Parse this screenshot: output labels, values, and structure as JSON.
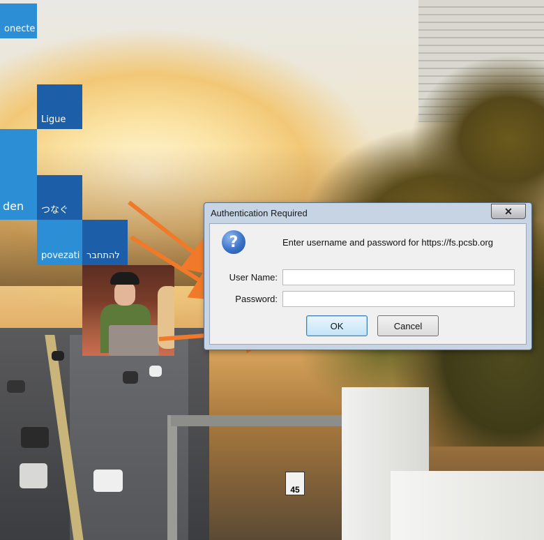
{
  "tiles": {
    "conecte": "onecte",
    "ligue": "Ligue",
    "den": "den",
    "tsunagu": "つなぐ",
    "povezati": "povezati",
    "hebrew": "להתחבר"
  },
  "road_sign": "45",
  "dialog": {
    "title": "Authentication Required",
    "close_label": "✕",
    "icon": "question-icon",
    "message": "Enter username and password for https://fs.pcsb.org",
    "username_label": "User Name:",
    "username_value": "",
    "password_label": "Password:",
    "password_value": "",
    "ok_label": "OK",
    "cancel_label": "Cancel"
  },
  "colors": {
    "arrow": "#f07a2a",
    "tile_light": "#2c8fd6",
    "tile_dark": "#1c5fa8",
    "dialog_frame": "#c7d4e3"
  }
}
